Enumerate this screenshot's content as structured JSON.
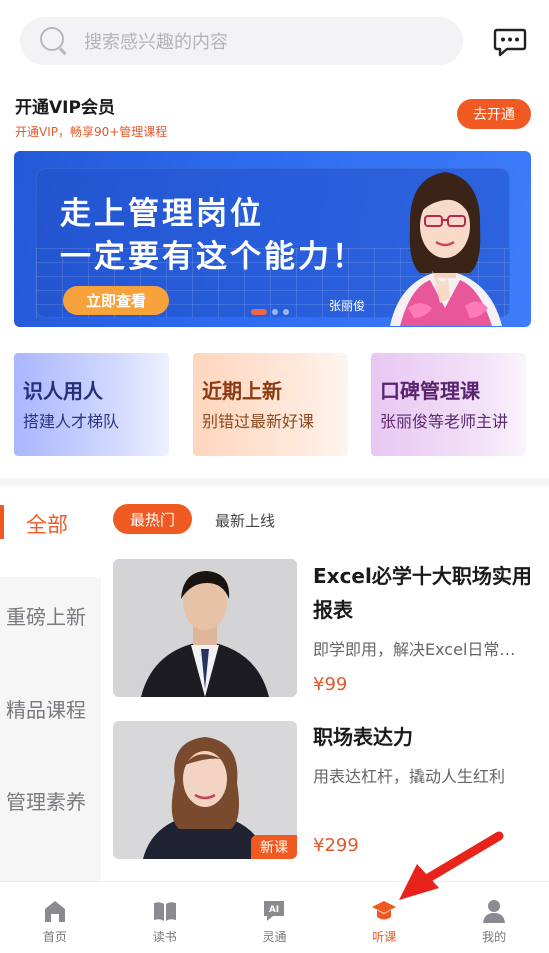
{
  "search": {
    "placeholder": "搜索感兴趣的内容"
  },
  "vip": {
    "title": "开通VIP会员",
    "subtitle": "开通VIP，畅享90+管理课程",
    "button": "去开通"
  },
  "banner": {
    "line1": "走上管理岗位",
    "line2": "一定要有这个能力！",
    "cta": "立即查看",
    "name": "张丽俊",
    "dots": 3,
    "active_dot": 0
  },
  "cards": [
    {
      "title": "识人用人",
      "subtitle": "搭建人才梯队"
    },
    {
      "title": "近期上新",
      "subtitle": "别错过最新好课"
    },
    {
      "title": "口碑管理课",
      "subtitle": "张丽俊等老师主讲"
    }
  ],
  "categories": {
    "selected": "全部",
    "items": [
      "重磅上新",
      "精品课程",
      "管理素养"
    ]
  },
  "tabs": {
    "hot": "最热门",
    "new": "最新上线"
  },
  "courses": [
    {
      "title": "Excel必学十大职场实用报表",
      "desc": "即学即用，解决Excel日常…",
      "price": "¥99"
    },
    {
      "title": "职场表达力",
      "desc": "用表达杠杆，撬动人生红利",
      "price": "¥299",
      "badge": "新课"
    }
  ],
  "nav": [
    {
      "label": "首页",
      "icon": "home-icon"
    },
    {
      "label": "读书",
      "icon": "book-icon"
    },
    {
      "label": "灵通",
      "icon": "ai-chat-icon"
    },
    {
      "label": "听课",
      "icon": "graduation-cap-icon",
      "active": true
    },
    {
      "label": "我的",
      "icon": "profile-icon"
    }
  ],
  "colors": {
    "accent": "#f05a22",
    "banner_blue": "#2d6cf0"
  }
}
